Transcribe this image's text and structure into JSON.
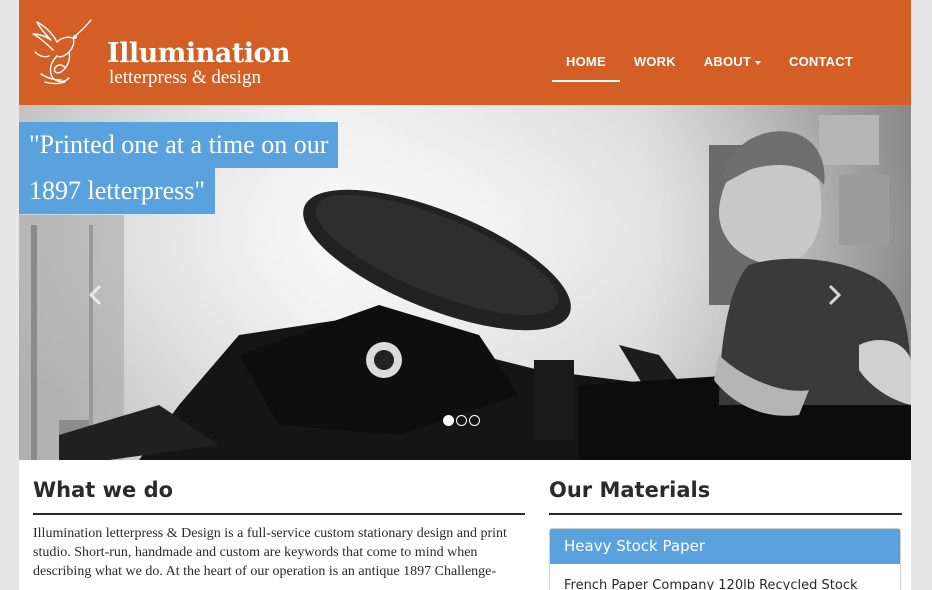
{
  "brand": {
    "name": "Illumination",
    "tagline": "letterpress & design"
  },
  "nav": {
    "items": [
      {
        "label": "HOME",
        "active": true
      },
      {
        "label": "WORK",
        "active": false
      },
      {
        "label": "ABOUT",
        "active": false,
        "dropdown": true
      },
      {
        "label": "CONTACT",
        "active": false
      }
    ]
  },
  "carousel": {
    "caption_line1": "\"Printed one at a time on our",
    "caption_line2": "1897 letterpress\"",
    "slide_count": 3,
    "active_slide": 1
  },
  "what_we_do": {
    "heading": "What we do",
    "lines": [
      "Illumination letterpress & Design is a full-service custom stationary design and print",
      "studio. Short-run, handmade and custom are keywords that come to mind when",
      "describing what we do. At the heart of our operation is an antique 1897 Challenge-"
    ]
  },
  "materials": {
    "heading": "Our Materials",
    "panel_title": "Heavy Stock Paper",
    "panel_item": "French Paper Company 120lb Recycled Stock"
  },
  "colors": {
    "brand_orange": "#d35f26",
    "accent_blue": "#5aa2de",
    "page_bg": "#e7e7e7"
  }
}
